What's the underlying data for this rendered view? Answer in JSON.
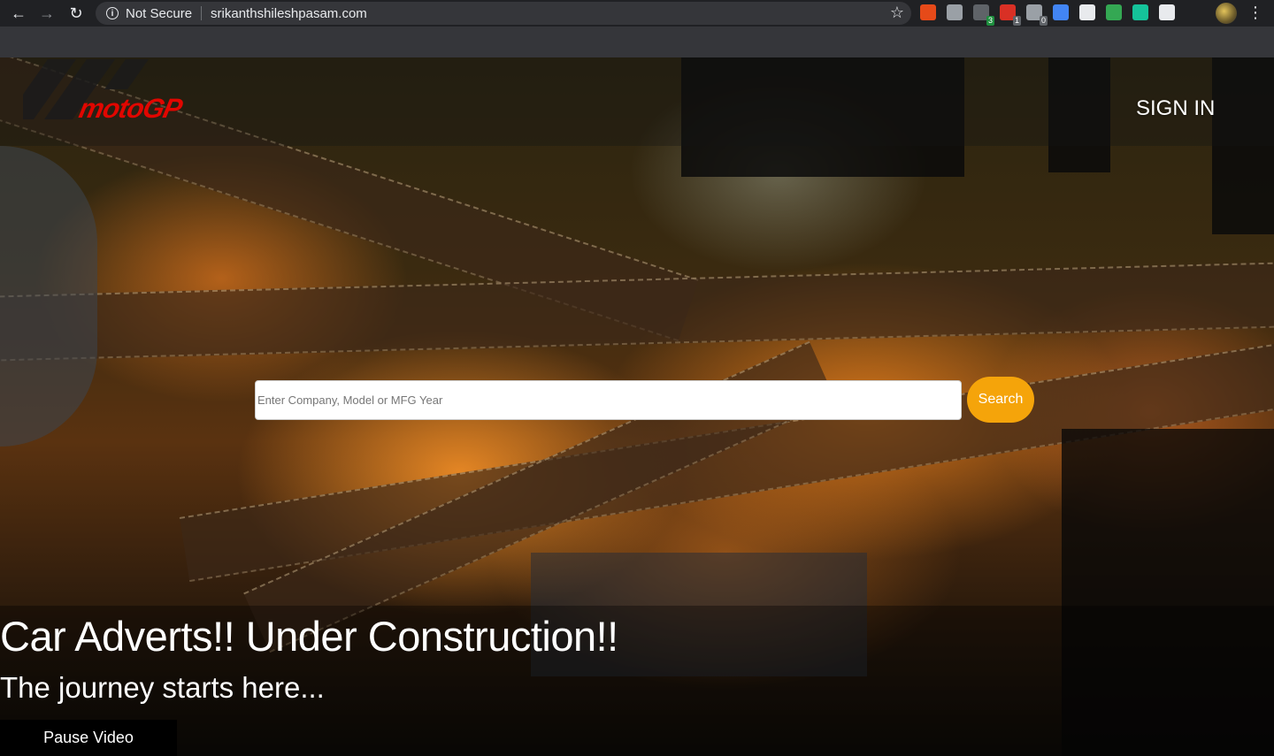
{
  "browser": {
    "security_status": "Not Secure",
    "url": "srikanthshileshpasam.com",
    "back_icon": "←",
    "forward_icon": "→",
    "reload_icon": "↻",
    "info_icon": "i",
    "star_icon": "☆",
    "menu_icon": "⋮",
    "extensions": [
      {
        "name": "office-extension-icon",
        "color": "#e64a19",
        "badge": ""
      },
      {
        "name": "camera-extension-icon",
        "color": "#9aa0a6",
        "badge": ""
      },
      {
        "name": "tab-extension-icon",
        "color": "#5f6368",
        "badge": "3",
        "badge_color": "#1e8e3e"
      },
      {
        "name": "red-extension-icon",
        "color": "#d93025",
        "badge": "1",
        "badge_color": "#5f6368"
      },
      {
        "name": "help-extension-icon",
        "color": "#9aa0a6",
        "badge": "0",
        "badge_color": "#5f6368"
      },
      {
        "name": "colorful-extension-icon",
        "color": "#4285f4",
        "badge": ""
      },
      {
        "name": "w-extension-icon",
        "color": "#e8eaed",
        "badge": ""
      },
      {
        "name": "mail-extension-icon",
        "color": "#34a853",
        "badge": ""
      },
      {
        "name": "grammarly-extension-icon",
        "color": "#15c39a",
        "badge": ""
      },
      {
        "name": "doc-extension-icon",
        "color": "#e8eaed",
        "badge": ""
      }
    ]
  },
  "site": {
    "logo_text": "motoGP",
    "sign_in_label": "SIGN IN",
    "search": {
      "placeholder": "Enter Company, Model or MFG Year",
      "value": "",
      "button_label": "Search"
    },
    "headline": "Car Adverts!! Under Construction!!",
    "subheadline": "The journey starts here...",
    "pause_button_label": "Pause Video"
  },
  "colors": {
    "search_button": "#f5a40a",
    "logo_red": "#e10600",
    "chrome_dark": "#202124"
  }
}
